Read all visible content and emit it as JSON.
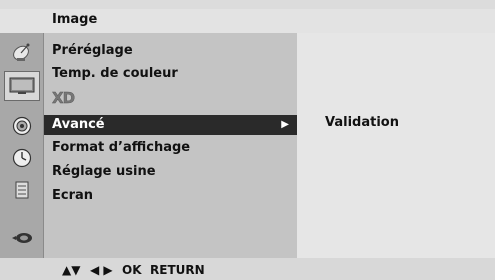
{
  "header": {
    "title": "Image"
  },
  "sidebar": {
    "icons": [
      {
        "name": "satellite-dish-icon",
        "active": false
      },
      {
        "name": "tv-screen-icon",
        "active": true
      },
      {
        "name": "speaker-icon",
        "active": false
      },
      {
        "name": "clock-icon",
        "active": false
      },
      {
        "name": "options-icon",
        "active": false
      },
      {
        "name": "input-source-icon",
        "active": false
      }
    ]
  },
  "menu": {
    "items": [
      {
        "label": "Préréglage"
      },
      {
        "label": "Temp. de couleur"
      },
      {
        "label": "XD"
      },
      {
        "label": "Avancé",
        "arrow": "▶"
      },
      {
        "label": "Format d’affichage"
      },
      {
        "label": "Réglage usine"
      },
      {
        "label": "Ecran"
      }
    ]
  },
  "submenu": {
    "items": [
      {
        "label": "Validation"
      }
    ]
  },
  "footer": {
    "nav_updown": "▲▼",
    "nav_leftright": "◀ ▶",
    "ok": "OK",
    "return": "RETURN"
  },
  "colors": {
    "selected_bg": "#2a2a2a",
    "menu_bg": "#c4c4c4",
    "submenu_bg": "#e6e6e6",
    "icon_col_bg": "#a8a8a8"
  }
}
